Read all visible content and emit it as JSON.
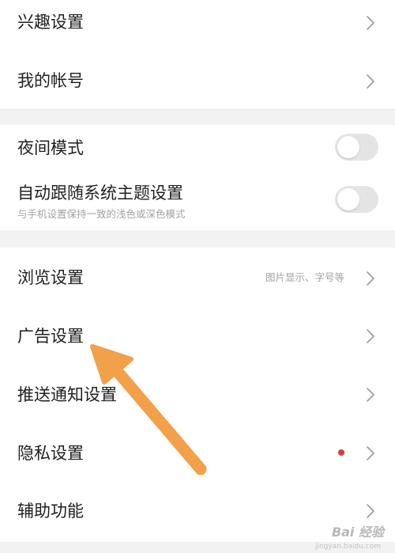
{
  "group1": {
    "interest_settings": "兴趣设置",
    "my_account": "我的帐号"
  },
  "group2": {
    "night_mode": {
      "label": "夜间模式",
      "enabled": false
    },
    "follow_system_theme": {
      "label": "自动跟随系统主题设置",
      "description": "与手机设置保持一致的浅色或深色模式",
      "enabled": false
    }
  },
  "group3": {
    "browse_settings": {
      "label": "浏览设置",
      "hint": "图片显示、字号等"
    },
    "ad_settings": "广告设置",
    "push_settings": "推送通知设置",
    "privacy_settings": {
      "label": "隐私设置",
      "has_badge": true,
      "badge_color": "#d93a3a"
    },
    "accessibility": "辅助功能"
  },
  "annotation": {
    "type": "arrow",
    "color": "#f2a04a",
    "points_to": "ad_settings"
  },
  "watermark": {
    "text": "Bai 经验",
    "url": "jingyan.baidu.com"
  }
}
